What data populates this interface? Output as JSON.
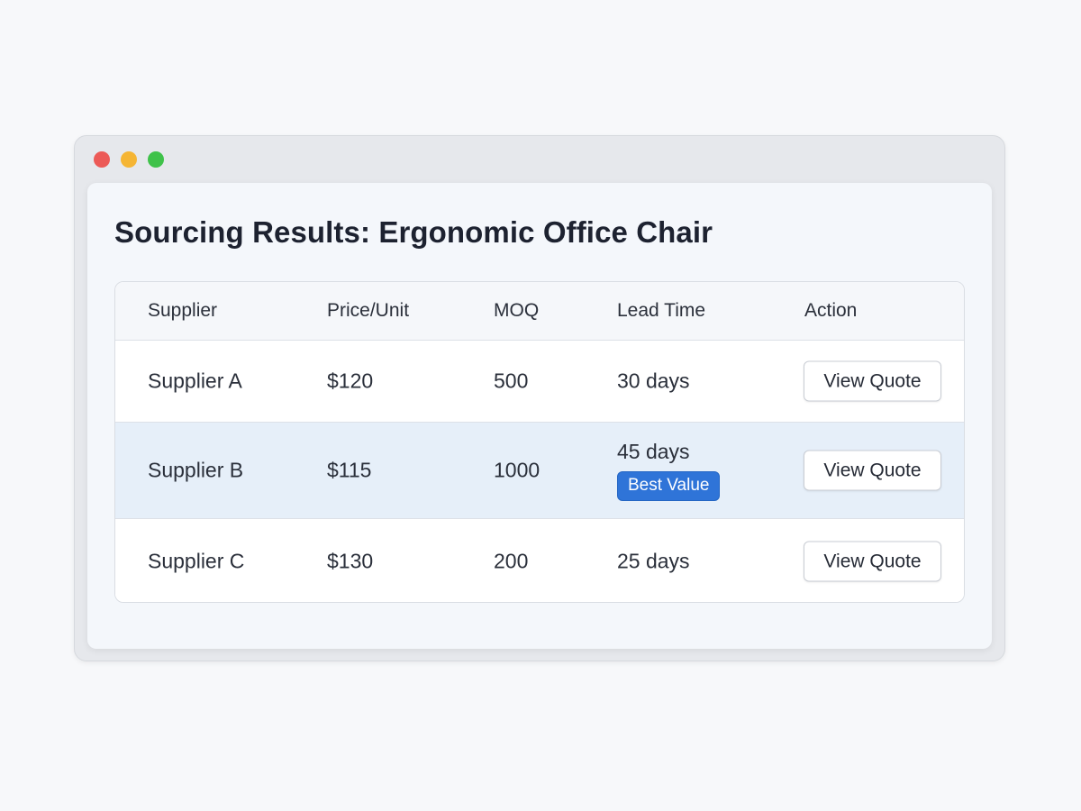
{
  "window": {
    "title": "Sourcing Results: Ergonomic Office Chair",
    "controls": [
      "close-icon",
      "minimize-icon",
      "maximize-icon"
    ]
  },
  "colors": {
    "accent": "#2f74d8",
    "highlight_row": "#e6eff9",
    "close": "#ec5a57",
    "minimize": "#f5b534",
    "maximize": "#3fc24a"
  },
  "table": {
    "columns": [
      "Supplier",
      "Price/Unit",
      "MOQ",
      "Lead Time",
      "Action"
    ],
    "rows": [
      {
        "supplier": "Supplier A",
        "price": "$120",
        "moq": "500",
        "lead_time": "30 days",
        "action": "View Quote"
      },
      {
        "supplier": "Supplier B",
        "price": "$115",
        "moq": "1000",
        "lead_time": "45 days",
        "badge": "Best Value",
        "action": "View Quote",
        "highlighted": true
      },
      {
        "supplier": "Supplier C",
        "price": "$130",
        "moq": "200",
        "lead_time": "25 days",
        "action": "View Quote"
      }
    ]
  }
}
